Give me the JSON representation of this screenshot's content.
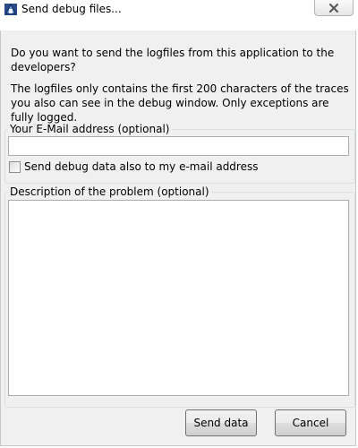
{
  "window": {
    "title": "Send debug files...",
    "app_icon": "debug-app-icon",
    "close_icon": "close-icon"
  },
  "intro": {
    "question": "Do you want to send the logfiles from this application to the developers?",
    "note": "The logfiles only contains the first 200 characters of the traces you also can see in the debug window. Only exceptions are fully logged."
  },
  "email_group": {
    "legend": "Your E-Mail address (optional)",
    "value": "",
    "placeholder": "",
    "checkbox_label": "Send debug data also to my e-mail address",
    "checkbox_checked": false
  },
  "description_group": {
    "legend": "Description of the problem (optional)",
    "value": ""
  },
  "buttons": {
    "send_label": "Send data",
    "cancel_label": "Cancel"
  },
  "colors": {
    "client_bg": "#f0f0f0",
    "group_border": "#d5dfe5",
    "input_border": "#abadb3"
  }
}
